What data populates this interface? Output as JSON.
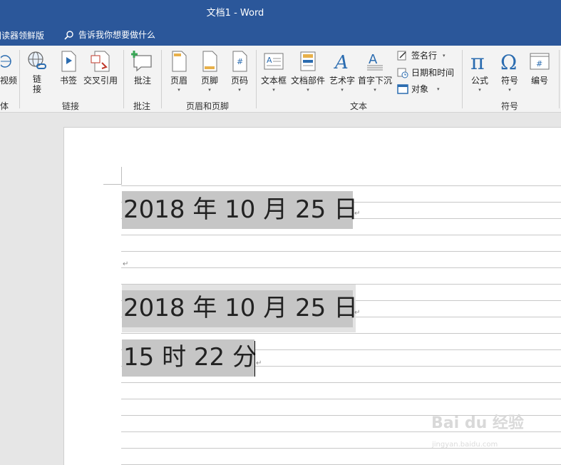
{
  "window": {
    "title": "文档1  -  Word"
  },
  "tell_bar": {
    "partial_tab": "阅读器领鲜版",
    "tell_me": "告诉我你想要做什么"
  },
  "ribbon": {
    "partial_left_btn": "视频",
    "partial_left_group": "体",
    "buttons": {
      "link": "链\n接",
      "bookmark": "书签",
      "cross_ref": "交叉引用",
      "comment": "批注",
      "header": "页眉",
      "footer": "页脚",
      "page_number": "页码",
      "textbox": "文本框",
      "quick_parts": "文档部件",
      "wordart": "艺术字",
      "dropcap": "首字下沉",
      "signature": "签名行",
      "datetime": "日期和时间",
      "object": "对象",
      "equation": "公式",
      "symbol": "符号",
      "numbering": "编号"
    },
    "groups": {
      "links": "链接",
      "comments": "批注",
      "header_footer": "页眉和页脚",
      "text": "文本",
      "symbols": "符号"
    }
  },
  "document": {
    "line1": "2018 年 10 月 25 日",
    "line2": "2018 年 10 月 25 日",
    "line3": "15 时 22 分",
    "para_mark": "↵"
  },
  "watermark": {
    "main": "Bai  du 经验",
    "sub": "jingyan.baidu.com"
  }
}
